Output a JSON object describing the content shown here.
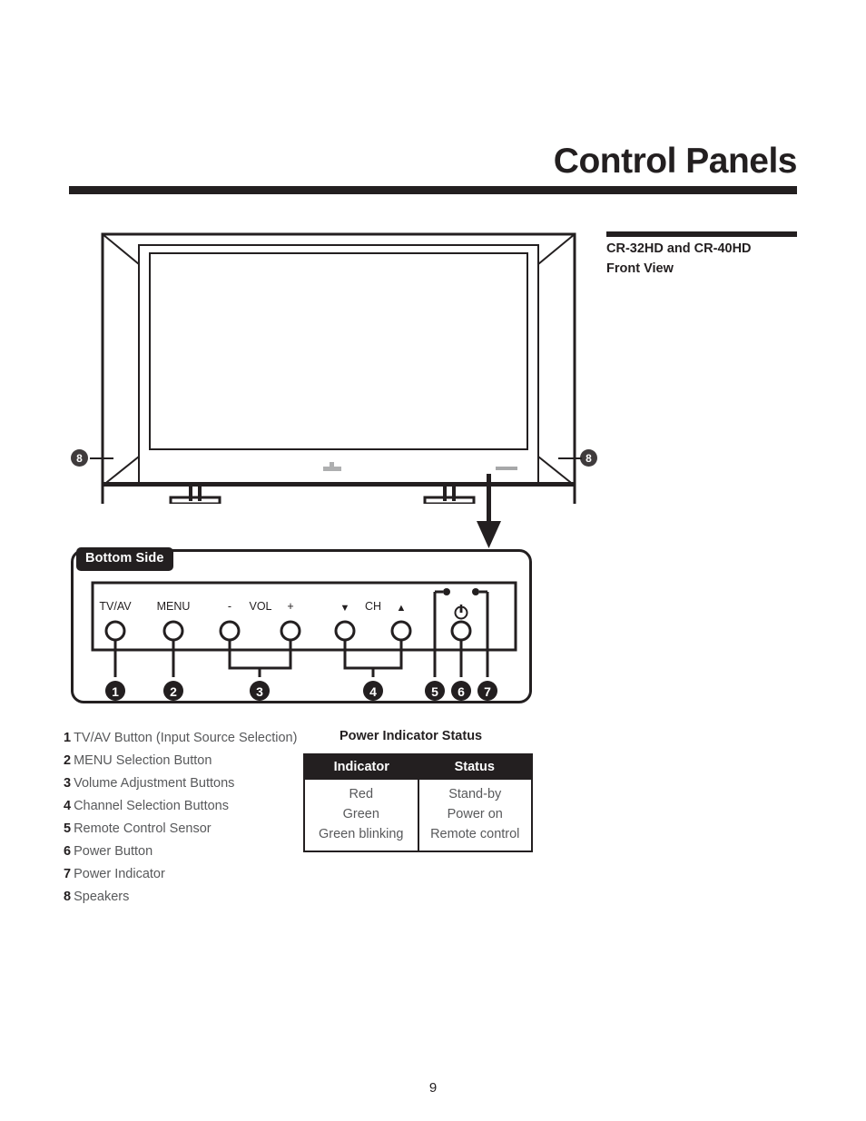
{
  "document": {
    "title": "Control Panels",
    "page_number": "9"
  },
  "figure": {
    "caption_line1": "CR-32HD and CR-40HD",
    "caption_line2": "Front View",
    "panel_tab_label": "Bottom Side",
    "speaker_callout_left": "8",
    "speaker_callout_right": "8",
    "controls": [
      {
        "label": "TV/AV",
        "callout": "1"
      },
      {
        "label": "MENU",
        "callout": "2"
      },
      {
        "label": "-",
        "callout": ""
      },
      {
        "label": "VOL",
        "callout": "3"
      },
      {
        "label": "+",
        "callout": ""
      },
      {
        "label": "▼",
        "callout": ""
      },
      {
        "label": "CH",
        "callout": "4"
      },
      {
        "label": "▲",
        "callout": ""
      },
      {
        "label": "⏻",
        "callout": "6"
      }
    ],
    "callout_numbers": [
      "1",
      "2",
      "3",
      "4",
      "5",
      "6",
      "7"
    ]
  },
  "legend": {
    "items": [
      {
        "num": "1",
        "text": "TV/AV Button (Input Source Selection)"
      },
      {
        "num": "2",
        "text": "MENU Selection Button"
      },
      {
        "num": "3",
        "text": "Volume Adjustment Buttons"
      },
      {
        "num": "4",
        "text": "Channel Selection Buttons"
      },
      {
        "num": "5",
        "text": "Remote Control Sensor"
      },
      {
        "num": "6",
        "text": "Power Button"
      },
      {
        "num": "7",
        "text": "Power Indicator"
      },
      {
        "num": "8",
        "text": "Speakers"
      }
    ]
  },
  "status_table": {
    "title": "Power Indicator Status",
    "columns": [
      "Indicator",
      "Status"
    ],
    "rows": [
      {
        "indicator": "Red",
        "status": "Stand-by"
      },
      {
        "indicator": "Green",
        "status": "Power on"
      },
      {
        "indicator": "Green blinking",
        "status": "Remote control"
      }
    ]
  },
  "colors": {
    "ink": "#231f20",
    "body_text": "#58595b",
    "badge_gray": "#3f3b3c"
  }
}
